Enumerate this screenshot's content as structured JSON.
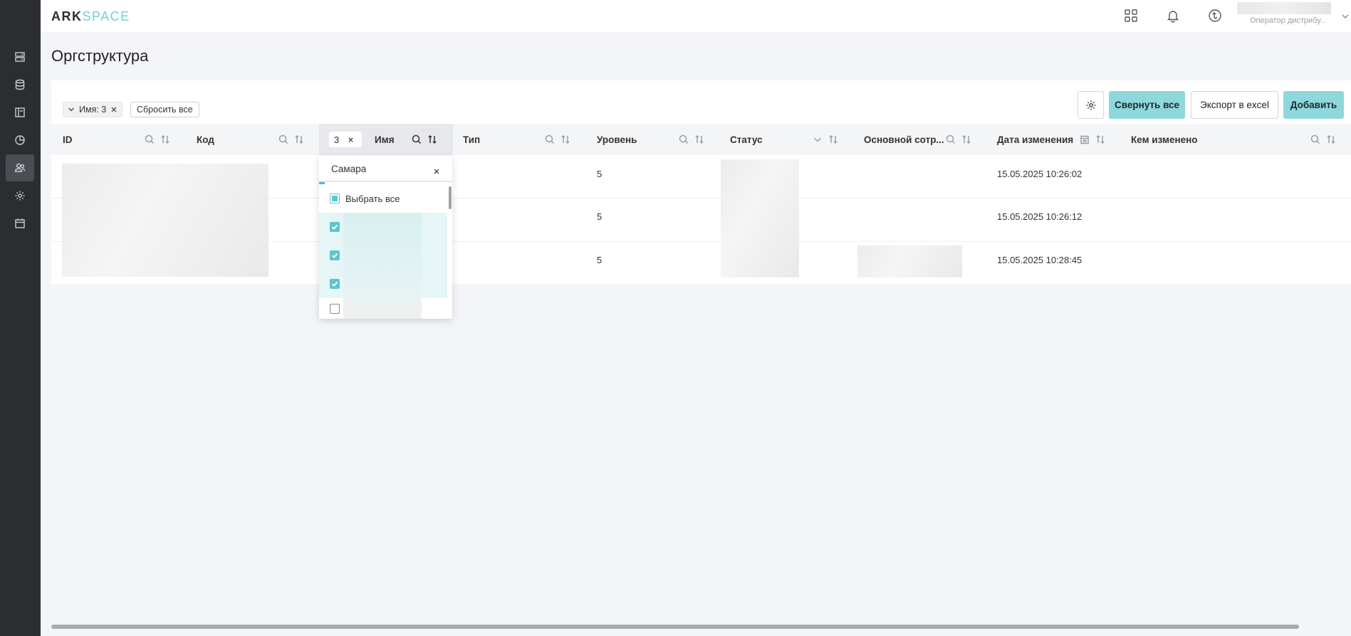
{
  "app": {
    "logo_part1": "ARK",
    "logo_part2": "SPACE",
    "user_role": "Оператор дистрибу..."
  },
  "sidebar": {
    "items": [
      {
        "icon": "server-icon",
        "active": false
      },
      {
        "icon": "database-icon",
        "active": false
      },
      {
        "icon": "layout-icon",
        "active": false
      },
      {
        "icon": "chart-pie-icon",
        "active": false
      },
      {
        "icon": "users-icon",
        "active": true
      },
      {
        "icon": "gear-icon",
        "active": false
      },
      {
        "icon": "calendar-icon",
        "active": false
      }
    ]
  },
  "header": {
    "icons": [
      "apps-grid-icon",
      "bell-icon",
      "sync-icon"
    ]
  },
  "page": {
    "title": "Оргструктура"
  },
  "toolbar": {
    "filter_chip": "Имя: 3",
    "reset_label": "Сбросить все",
    "collapse_label": "Свернуть все",
    "export_label": "Экспорт в excel",
    "add_label": "Добавить"
  },
  "table": {
    "columns": {
      "id": "ID",
      "code": "Код",
      "name": "Имя",
      "name_filter_count": "3",
      "type": "Тип",
      "level": "Уровень",
      "status": "Статус",
      "main_employee": "Основной сотр...",
      "modified_date": "Дата изменения",
      "modified_by": "Кем изменено"
    },
    "rows": [
      {
        "level": "5",
        "modified_date": "15.05.2025 10:26:02"
      },
      {
        "level": "5",
        "modified_date": "15.05.2025 10:26:12"
      },
      {
        "level": "5",
        "modified_date": "15.05.2025 10:28:45"
      }
    ]
  },
  "name_filter": {
    "search_value": "Самара",
    "select_all_label": "Выбрать все",
    "options_checked": [
      true,
      true,
      true,
      false
    ]
  },
  "colors": {
    "accent": "#8ed7dc",
    "sidebar_bg": "#2b2d31"
  }
}
